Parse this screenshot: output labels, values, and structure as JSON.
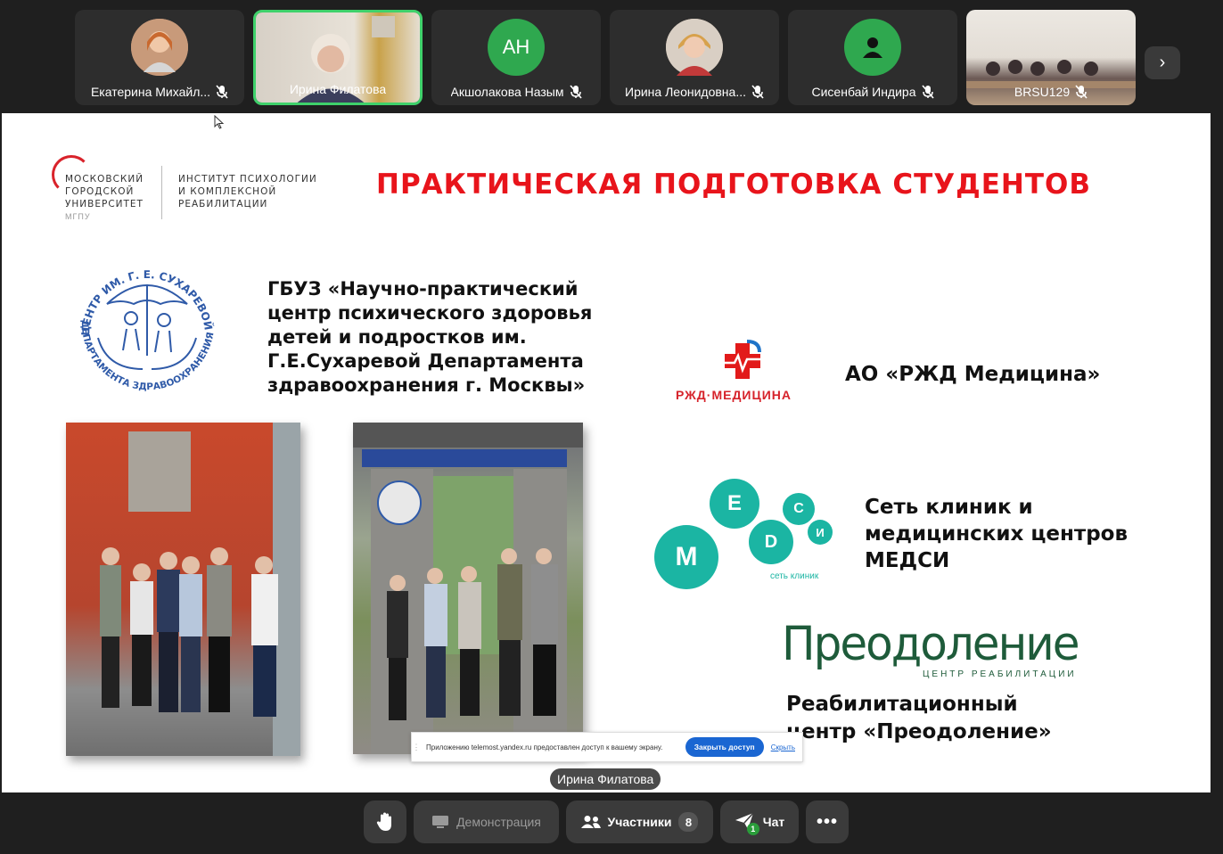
{
  "participants": [
    {
      "name": "Екатерина Михайл...",
      "mic": "mic-off-icon",
      "avatar_color": "#c8967a",
      "initials": ""
    },
    {
      "name": "Ирина Филатова",
      "mic": "",
      "avatar_color": "#d8cfc2",
      "initials": "",
      "speaking": true
    },
    {
      "name": "Акшолакова Назым",
      "mic": "mic-off-icon",
      "avatar_color": "#2fa84f",
      "initials": "AH"
    },
    {
      "name": "Ирина Леонидовна...",
      "mic": "mic-off-icon",
      "avatar_color": "#c9b29a",
      "initials": ""
    },
    {
      "name": "Сисенбай Индира",
      "mic": "mic-off-icon",
      "avatar_color": "#2fa84f",
      "initials": ""
    },
    {
      "name": "BRSU129",
      "mic": "mic-off-icon",
      "avatar_color": "#9a8c84",
      "initials": ""
    }
  ],
  "slide": {
    "title": "ПРАКТИЧЕСКАЯ ПОДГОТОВКА СТУДЕНТОВ",
    "mgpu_left": "МОСКОВСКИЙ\nГОРОДСКОЙ\nУНИВЕРСИТЕТ",
    "mgpu_abbr": "МГПУ",
    "mgpu_right": "ИНСТИТУТ ПСИХОЛОГИИ\nИ КОМПЛЕКСНОЙ\nРЕАБИЛИТАЦИИ",
    "sukhareva_logo_top": "ЦЕНТР ИМ. Г. Е. СУХАРЕВОЙ",
    "sukhareva_logo_bottom": "ДЕПАРТАМЕНТА ЗДРАВООХРАНЕНИЯ Г. МОСКВЫ",
    "gbuz_text": "ГБУЗ «Научно-практический центр психического здоровья детей и подростков им. Г.Е.Сухаревой Департамента здравоохранения г. Москвы»",
    "rzd_logo": "РЖД·МЕДИЦИНА",
    "rzd_text": "АО «РЖД Медицина»",
    "medsi_letters": [
      "M",
      "E",
      "D",
      "C",
      "И"
    ],
    "medsi_sub": "сеть клиник",
    "medsi_text": "Сеть клиник и медицинских центров МЕДСИ",
    "preod_logo": "Преодоление",
    "preod_sub": "ЦЕНТР РЕАБИЛИТАЦИИ",
    "preod_text": "Реабилитационный центр «Преодоление»"
  },
  "share_bar": {
    "message": "Приложению telemost.yandex.ru предоставлен доступ к вашему экрану.",
    "stop_label": "Закрыть доступ",
    "hide_label": "Скрыть"
  },
  "presenter": "Ирина Филатова",
  "toolbar": {
    "demo_label": "Демонстрация",
    "participants_label": "Участники",
    "participants_count": "8",
    "chat_label": "Чат",
    "chat_unread": "1"
  },
  "colors": {
    "title_red": "#e8141b",
    "accent_green": "#3fd16b",
    "medsi_teal": "#1bb5a3",
    "preod_green": "#1e5b3a"
  }
}
